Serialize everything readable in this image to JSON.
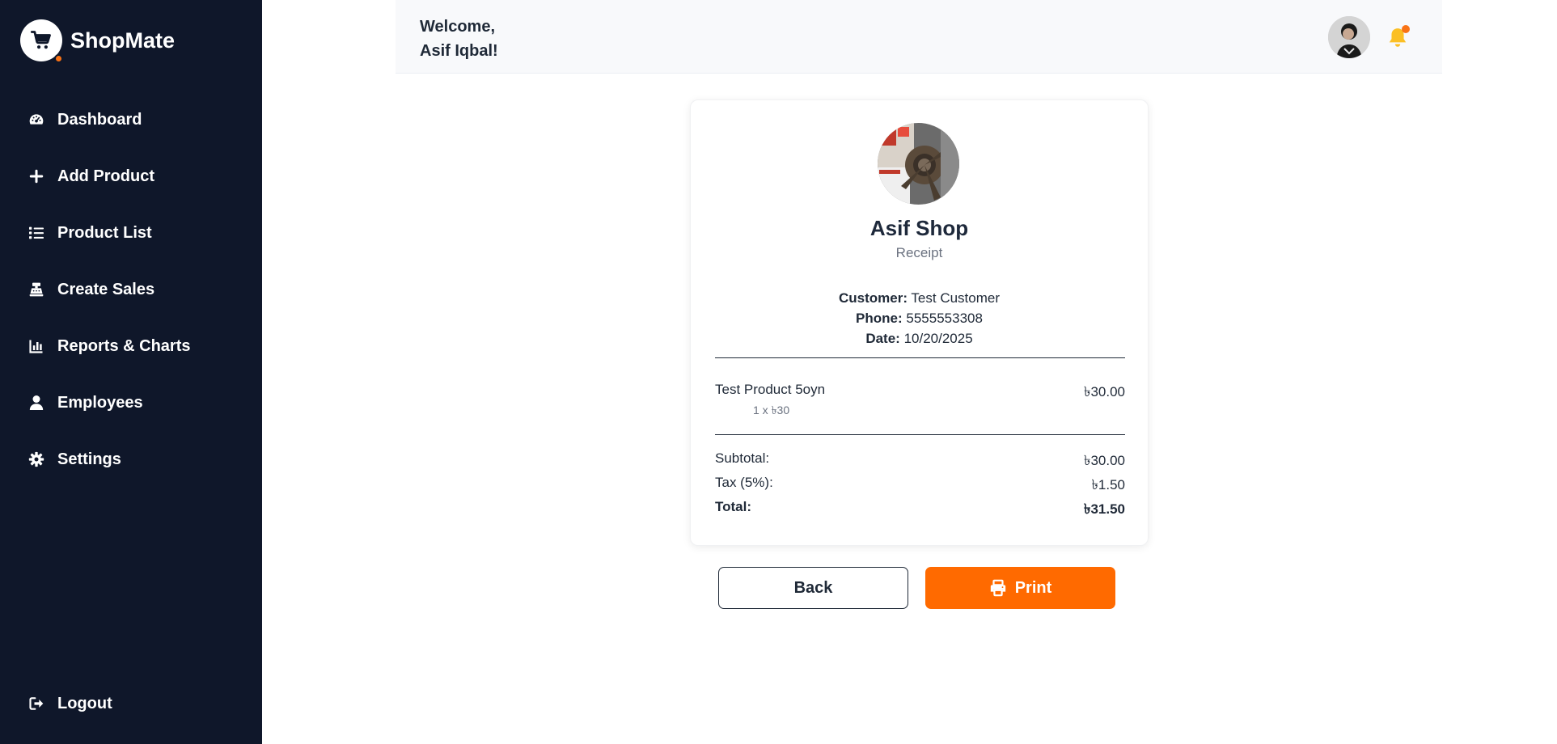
{
  "brand": {
    "name": "ShopMate",
    "icon": "cart-icon",
    "accent": "#f97316"
  },
  "sidebar": {
    "items": [
      {
        "label": "Dashboard",
        "icon": "gauge-icon"
      },
      {
        "label": "Add Product",
        "icon": "plus-icon"
      },
      {
        "label": "Product List",
        "icon": "list-icon"
      },
      {
        "label": "Create Sales",
        "icon": "cash-register-icon"
      },
      {
        "label": "Reports & Charts",
        "icon": "bar-chart-icon"
      },
      {
        "label": "Employees",
        "icon": "user-icon"
      },
      {
        "label": "Settings",
        "icon": "gear-icon"
      }
    ],
    "logout": {
      "label": "Logout",
      "icon": "logout-icon"
    },
    "background": "#0f172a"
  },
  "header": {
    "greeting": "Welcome,",
    "user_name": "Asif Iqbal!"
  },
  "receipt": {
    "shop_name": "Asif Shop",
    "subtitle": "Receipt",
    "customer_label": "Customer:",
    "customer": "Test Customer",
    "phone_label": "Phone:",
    "phone": "5555553308",
    "date_label": "Date:",
    "date": "10/20/2025",
    "items": [
      {
        "name": "Test Product 5oyn",
        "qty_price": "1 x ৳30",
        "amount": "৳30.00"
      }
    ],
    "subtotal_label": "Subtotal:",
    "subtotal": "৳30.00",
    "tax_label": "Tax (5%):",
    "tax": "৳1.50",
    "total_label": "Total:",
    "total": "৳31.50"
  },
  "actions": {
    "back_label": "Back",
    "print_label": "Print",
    "print_color": "#ff6a00"
  }
}
